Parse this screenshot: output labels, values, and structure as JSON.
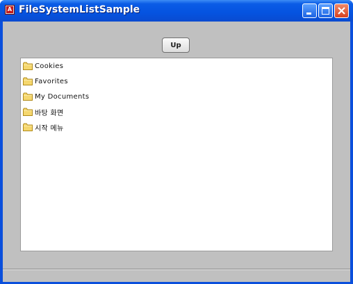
{
  "window": {
    "title": "FileSystemListSample",
    "app_icon_glyph": "A",
    "controls": [
      "minimize-icon",
      "maximize-icon",
      "close-icon"
    ]
  },
  "toolbar": {
    "up_label": "Up"
  },
  "file_list": {
    "items": [
      {
        "label": "Cookies",
        "icon": "folder-icon"
      },
      {
        "label": "Favorites",
        "icon": "folder-icon"
      },
      {
        "label": "My Documents",
        "icon": "folder-icon"
      },
      {
        "label": "바탕 화면",
        "icon": "folder-icon"
      },
      {
        "label": "시작 메뉴",
        "icon": "folder-icon"
      }
    ]
  },
  "colors": {
    "titlebar": "#0553e0",
    "client_background": "#c0c0c0",
    "list_background": "#ffffff",
    "folder": "#f5d76e"
  }
}
